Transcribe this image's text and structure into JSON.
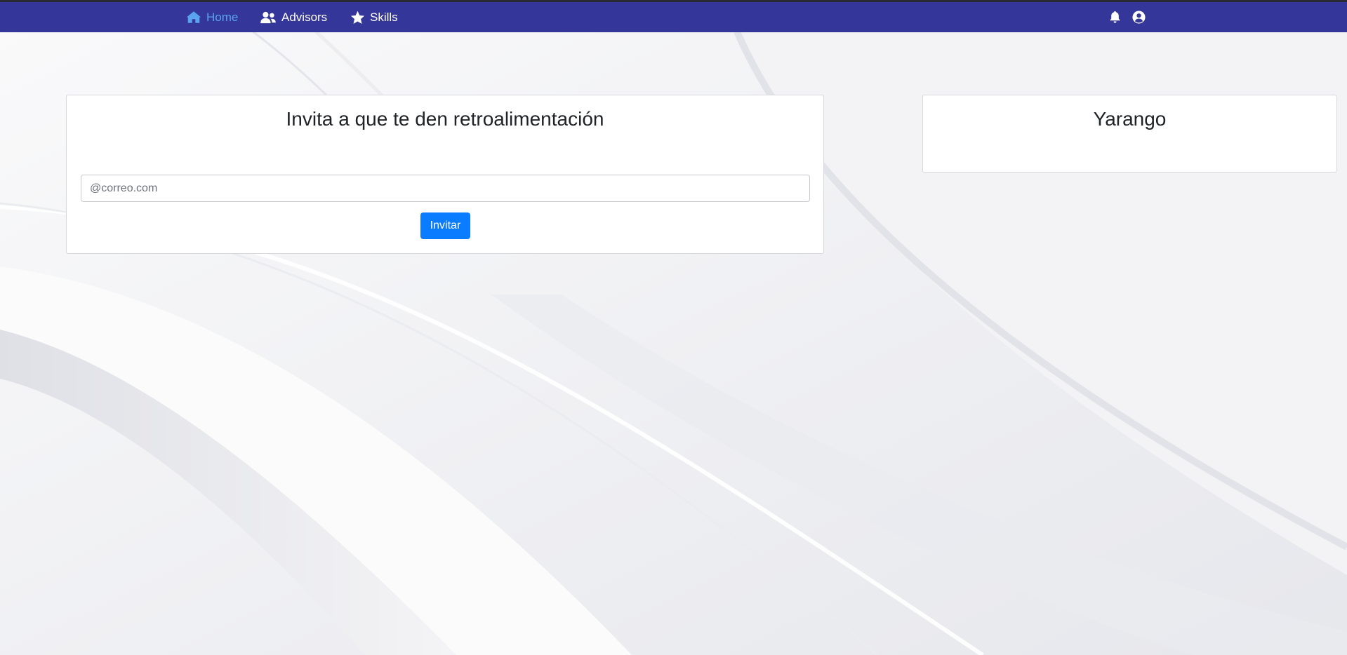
{
  "nav": {
    "items": [
      {
        "label": "Home",
        "icon": "home-icon",
        "active": true
      },
      {
        "label": "Advisors",
        "icon": "users-icon",
        "active": false
      },
      {
        "label": "Skills",
        "icon": "star-icon",
        "active": false
      }
    ],
    "right_icons": [
      "bell-icon",
      "user-circle-icon"
    ],
    "colors": {
      "background": "#34369a",
      "active": "#5aa3f0",
      "text": "#ffffff"
    }
  },
  "invite_card": {
    "title": "Invita a que te den retroalimentación",
    "email_placeholder": "@correo.com",
    "email_value": "",
    "button_label": "Invitar"
  },
  "profile_card": {
    "name": "Yarango"
  },
  "colors": {
    "primary_button": "#0a7cff"
  }
}
